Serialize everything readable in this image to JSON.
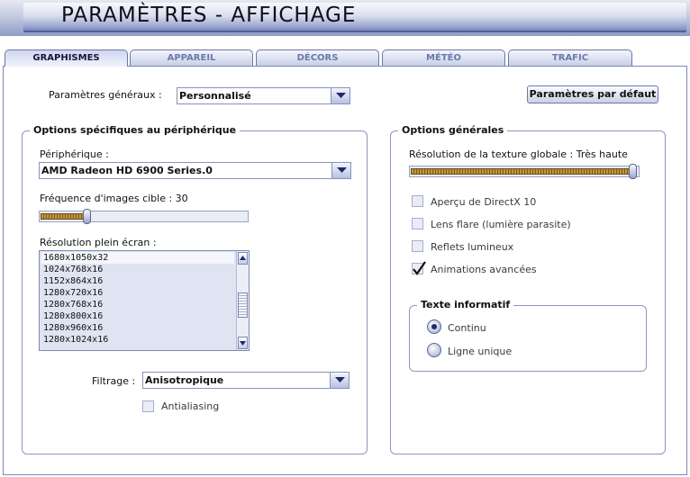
{
  "header": {
    "title": "PARAMÈTRES - AFFICHAGE"
  },
  "tabs": [
    {
      "label": "GRAPHISMES",
      "active": true
    },
    {
      "label": "APPAREIL",
      "active": false
    },
    {
      "label": "DÉCORS",
      "active": false
    },
    {
      "label": "MÉTÉO",
      "active": false
    },
    {
      "label": "TRAFIC",
      "active": false
    }
  ],
  "general": {
    "label": "Paramètres généraux :",
    "value": "Personnalisé"
  },
  "default_button": {
    "label": "Paramètres par défaut"
  },
  "device_group": {
    "title": "Options spécifiques au périphérique",
    "device_label": "Périphérique :",
    "device_value": "AMD Radeon HD 6900 Series.0",
    "frame_rate_label": "Fréquence d'images cible : 30",
    "frame_rate_level": 0.22,
    "resolution_label": "Résolution plein écran :",
    "resolutions": [
      "1680x1050x32",
      "1024x768x16",
      "1152x864x16",
      "1280x720x16",
      "1280x768x16",
      "1280x800x16",
      "1280x960x16",
      "1280x1024x16"
    ],
    "filter_label": "Filtrage :",
    "filter_value": "Anisotropique",
    "antialiasing_label": "Antialiasing",
    "antialiasing_checked": false
  },
  "general_group": {
    "title": "Options générales",
    "texture_label": "Résolution de la texture globale : Très haute",
    "texture_level": 1.0,
    "options": [
      {
        "label": "Aperçu de DirectX 10",
        "checked": false
      },
      {
        "label": "Lens flare (lumière parasite)",
        "checked": false
      },
      {
        "label": "Reflets lumineux",
        "checked": false
      },
      {
        "label": "Animations avancées",
        "checked": true
      }
    ]
  },
  "info_group": {
    "title": "Texte informatif",
    "options": [
      {
        "label": "Continu",
        "selected": true
      },
      {
        "label": "Ligne unique",
        "selected": false
      }
    ]
  }
}
